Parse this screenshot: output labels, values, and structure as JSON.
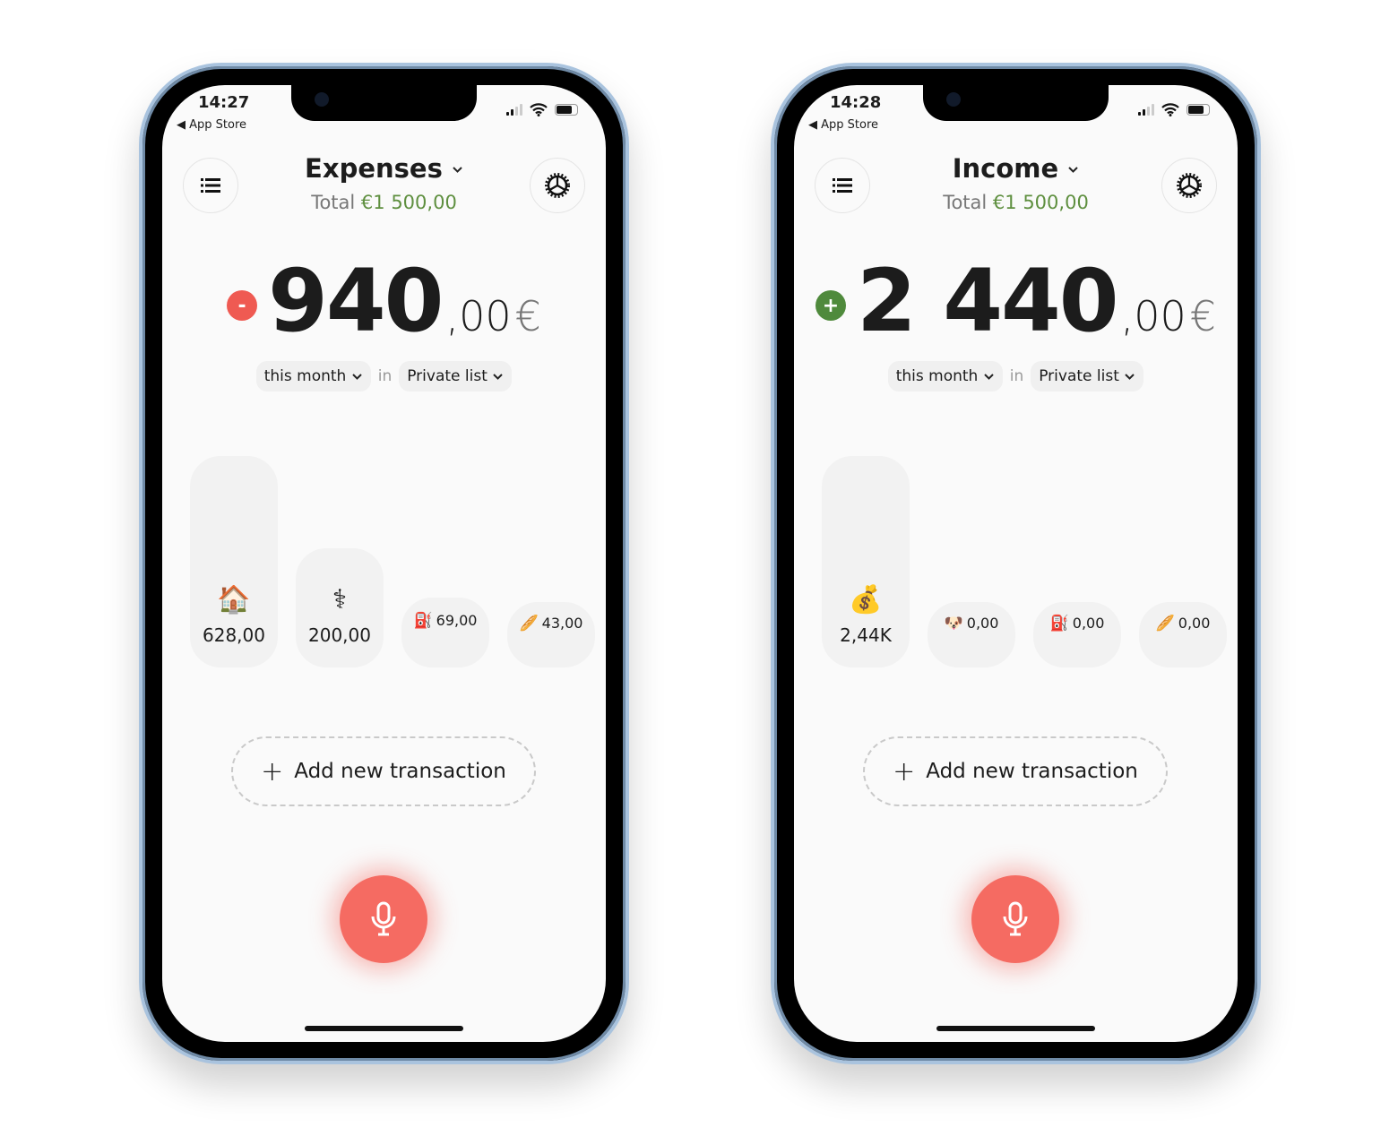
{
  "phones": [
    {
      "status": {
        "time": "14:27",
        "back_label": "◀ App Store"
      },
      "header": {
        "title": "Expenses",
        "total_label": "Total",
        "total_amount": "€1 500,00"
      },
      "amount": {
        "sign": "-",
        "sign_color": "#ef5a52",
        "integer": "940",
        "decimals": ",00",
        "currency": "€"
      },
      "filters": {
        "period": "this month",
        "in_label": "in",
        "list": "Private list"
      },
      "categories": [
        {
          "emoji": "🏠",
          "label": "628,00",
          "value": 628
        },
        {
          "emoji": "⚕",
          "label": "200,00",
          "value": 200
        },
        {
          "emoji": "⛽",
          "label": "69,00",
          "value": 69
        },
        {
          "emoji": "🥖",
          "label": "43,00",
          "value": 43
        }
      ],
      "add_label": "Add new transaction"
    },
    {
      "status": {
        "time": "14:28",
        "back_label": "◀ App Store"
      },
      "header": {
        "title": "Income",
        "total_label": "Total",
        "total_amount": "€1 500,00"
      },
      "amount": {
        "sign": "+",
        "sign_color": "#4f8a3c",
        "integer": "2 440",
        "decimals": ",00",
        "currency": "€"
      },
      "filters": {
        "period": "this month",
        "in_label": "in",
        "list": "Private list"
      },
      "categories": [
        {
          "emoji": "💰",
          "label": "2,44K",
          "value": 2440
        },
        {
          "emoji": "🐶",
          "label": "0,00",
          "value": 0
        },
        {
          "emoji": "⛽",
          "label": "0,00",
          "value": 0
        },
        {
          "emoji": "🥖",
          "label": "0,00",
          "value": 0
        }
      ],
      "add_label": "Add new transaction"
    }
  ],
  "icons": {
    "menu": "list-icon",
    "settings": "gear-icon",
    "mic": "microphone-icon",
    "chevron": "chevron-down-icon"
  },
  "colors": {
    "accent": "#f56b62",
    "total_green": "#5e8f3f"
  }
}
